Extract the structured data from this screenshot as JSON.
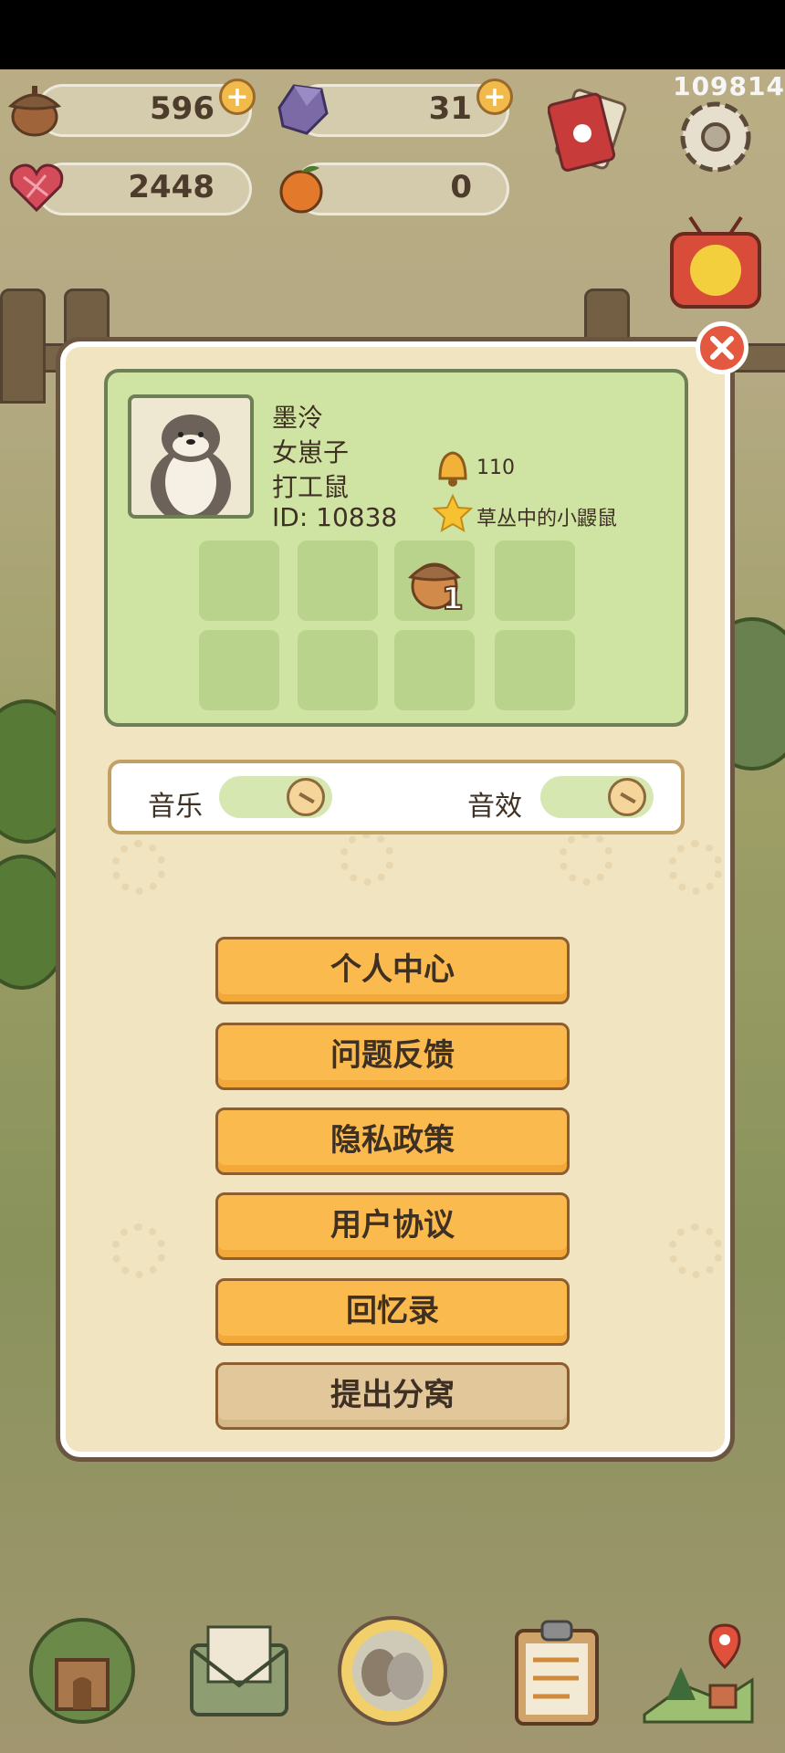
{
  "status": {
    "corner_number": "109814"
  },
  "resources": [
    {
      "name": "acorn",
      "value": "596",
      "icon": "acorn-icon",
      "has_plus": true
    },
    {
      "name": "crystal",
      "value": "31",
      "icon": "crystal-icon",
      "has_plus": true
    },
    {
      "name": "heart",
      "value": "2448",
      "icon": "heart-icon",
      "has_plus": false
    },
    {
      "name": "orange",
      "value": "0",
      "icon": "orange-icon",
      "has_plus": false
    }
  ],
  "profile": {
    "name": "墨泠",
    "title": "女崽子",
    "role": "打工鼠",
    "id_text": "ID: 10838",
    "bell_count": "110",
    "badge_text": "草丛中的小鼹鼠",
    "slot_item_count": "1"
  },
  "settings": {
    "music_label": "音乐",
    "sfx_label": "音效"
  },
  "menu": {
    "personal_center": "个人中心",
    "feedback": "问题反馈",
    "privacy": "隐私政策",
    "user_agreement": "用户协议",
    "memoirs": "回忆录",
    "leave_den": "提出分窝"
  },
  "colors": {
    "menu_orange": "#fbba4d",
    "menu_beige": "#e2c79b",
    "close_red": "#e4583f",
    "profile_green": "#cfe3a2"
  }
}
